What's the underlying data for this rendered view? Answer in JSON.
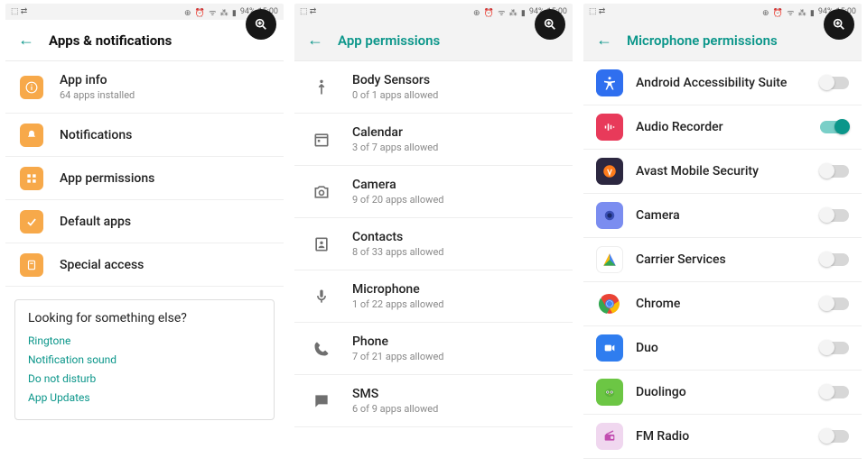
{
  "status": {
    "battery": "94%",
    "time": "15:00"
  },
  "screen1": {
    "title": "Apps & notifications",
    "items": [
      {
        "label": "App info",
        "sub": "64 apps installed"
      },
      {
        "label": "Notifications"
      },
      {
        "label": "App permissions"
      },
      {
        "label": "Default apps"
      },
      {
        "label": "Special access"
      }
    ],
    "card": {
      "title": "Looking for something else?",
      "links": [
        "Ringtone",
        "Notification sound",
        "Do not disturb",
        "App Updates"
      ]
    }
  },
  "screen2": {
    "title": "App permissions",
    "items": [
      {
        "label": "Body Sensors",
        "sub": "0 of 1 apps allowed",
        "icon": "body-icon"
      },
      {
        "label": "Calendar",
        "sub": "3 of 7 apps allowed",
        "icon": "calendar-icon"
      },
      {
        "label": "Camera",
        "sub": "9 of 20 apps allowed",
        "icon": "camera-icon"
      },
      {
        "label": "Contacts",
        "sub": "8 of 33 apps allowed",
        "icon": "contacts-icon"
      },
      {
        "label": "Microphone",
        "sub": "1 of 22 apps allowed",
        "icon": "microphone-icon"
      },
      {
        "label": "Phone",
        "sub": "7 of 21 apps allowed",
        "icon": "phone-icon"
      },
      {
        "label": "SMS",
        "sub": "6 of 9 apps allowed",
        "icon": "sms-icon"
      }
    ]
  },
  "screen3": {
    "title": "Microphone permissions",
    "apps": [
      {
        "label": "Android Accessibility Suite",
        "color": "#2f6fef",
        "on": false,
        "icon": "accessibility-icon"
      },
      {
        "label": "Audio Recorder",
        "color": "#e83a5a",
        "on": true,
        "icon": "audio-recorder-icon"
      },
      {
        "label": "Avast Mobile Security",
        "color": "#2c2740",
        "on": false,
        "icon": "avast-icon"
      },
      {
        "label": "Camera",
        "color": "#7b8df0",
        "on": false,
        "icon": "camera-app-icon"
      },
      {
        "label": "Carrier Services",
        "color": "#ffffff",
        "on": false,
        "icon": "carrier-icon"
      },
      {
        "label": "Chrome",
        "color": "#ffffff",
        "on": false,
        "icon": "chrome-icon"
      },
      {
        "label": "Duo",
        "color": "#2f7def",
        "on": false,
        "icon": "duo-icon"
      },
      {
        "label": "Duolingo",
        "color": "#6cc644",
        "on": false,
        "icon": "duolingo-icon"
      },
      {
        "label": "FM Radio",
        "color": "#f0d7ef",
        "on": false,
        "icon": "radio-icon"
      }
    ]
  }
}
